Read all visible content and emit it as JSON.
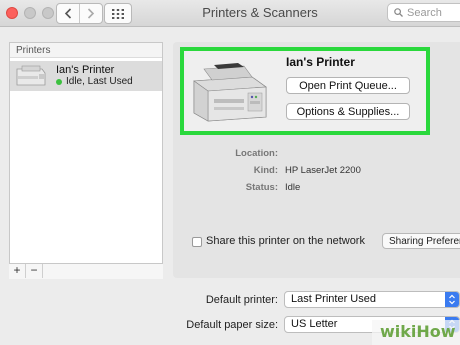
{
  "window": {
    "title": "Printers & Scanners"
  },
  "search": {
    "placeholder": "Search"
  },
  "printers_list": {
    "header": "Printers",
    "items": [
      {
        "name": "Ian's Printer",
        "status": "Idle, Last Used"
      }
    ],
    "add_label": "+",
    "remove_label": "−"
  },
  "printer_detail": {
    "name": "Ian's Printer",
    "open_queue_label": "Open Print Queue...",
    "options_label": "Options & Supplies...",
    "fields": [
      {
        "label": "Location:",
        "value": ""
      },
      {
        "label": "Kind:",
        "value": "HP LaserJet 2200"
      },
      {
        "label": "Status:",
        "value": "Idle"
      }
    ],
    "share_label": "Share this printer on the network",
    "share_checked": false,
    "sharing_prefs_label": "Sharing Preferences..."
  },
  "defaults": {
    "printer_label": "Default printer:",
    "printer_value": "Last Printer Used",
    "paper_label": "Default paper size:",
    "paper_value": "US Letter"
  },
  "watermark": {
    "text": "wikiHow"
  },
  "colors": {
    "highlight": "#2ad83c",
    "status_dot": "#3cc13f",
    "select_accent": "#3a7bf0",
    "close_button": "#fc605c"
  },
  "icons": [
    "back-icon",
    "forward-icon",
    "grid-icon",
    "search-icon",
    "printer-icon",
    "chevron-updown-icon"
  ]
}
